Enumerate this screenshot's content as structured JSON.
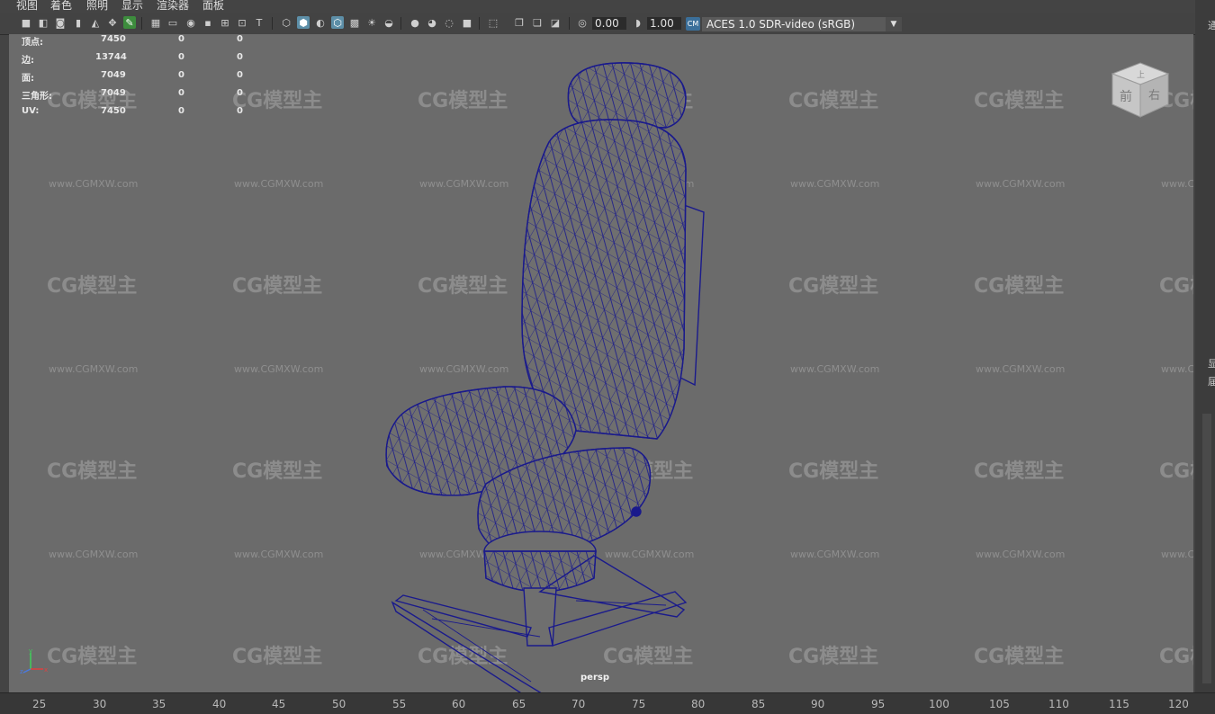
{
  "menu": {
    "items": [
      "视图",
      "着色",
      "照明",
      "显示",
      "渲染器",
      "面板"
    ]
  },
  "toolbar": {
    "exposure_value": "0.00",
    "gamma_value": "1.00",
    "color_management": {
      "badge": "CM",
      "selected": "ACES 1.0 SDR-video (sRGB)"
    }
  },
  "hud": {
    "rows": [
      {
        "label": "顶点:",
        "a": "7450",
        "b": "0",
        "c": "0"
      },
      {
        "label": "边:",
        "a": "13744",
        "b": "0",
        "c": "0"
      },
      {
        "label": "面:",
        "a": "7049",
        "b": "0",
        "c": "0"
      },
      {
        "label": "三角形:",
        "a": "7049",
        "b": "0",
        "c": "0"
      },
      {
        "label": "UV:",
        "a": "7450",
        "b": "0",
        "c": "0"
      }
    ]
  },
  "viewport": {
    "camera_label": "persp",
    "watermark_logo": "CG模型主",
    "watermark_url": "www.CGMXW.com",
    "viewcube": {
      "top": "上",
      "front": "前",
      "right": "右"
    },
    "axis": {
      "x": "x",
      "y": "y",
      "z": "z"
    }
  },
  "ruler": {
    "ticks": [
      "25",
      "30",
      "35",
      "40",
      "45",
      "50",
      "55",
      "60",
      "65",
      "70",
      "75",
      "80",
      "85",
      "90",
      "95",
      "100",
      "105",
      "110",
      "115",
      "120"
    ]
  },
  "right_panel": {
    "top_char": "通",
    "mid_char_1": "显",
    "mid_char_2": "届"
  },
  "colors": {
    "viewport_bg": "#6b6b6b",
    "wireframe": "#1a1a8c",
    "ui_dark": "#444444"
  }
}
